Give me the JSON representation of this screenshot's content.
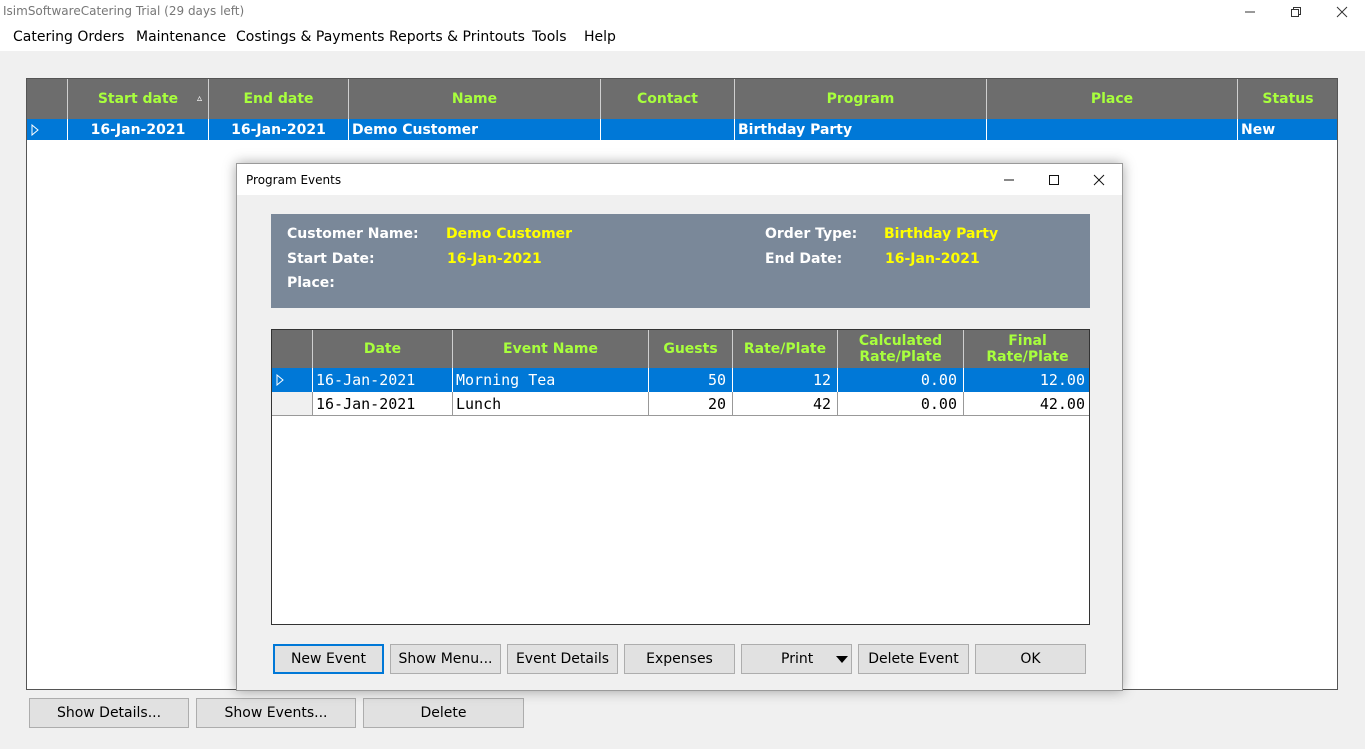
{
  "window": {
    "title": "IsimSoftwareCatering Trial (29 days left)",
    "controls": [
      "minimize-icon",
      "restore-icon",
      "close-icon"
    ]
  },
  "menu": {
    "items": [
      "Catering Orders",
      "Maintenance",
      "Costings & Payments",
      "Reports & Printouts",
      "Tools",
      "Help"
    ]
  },
  "orders_grid": {
    "columns": [
      "Start date",
      "End date",
      "Name",
      "Contact",
      "Program",
      "Place",
      "Status"
    ],
    "sort_indicator": "▵",
    "rows": [
      {
        "start_date": "16-Jan-2021",
        "end_date": "16-Jan-2021",
        "name": "Demo Customer",
        "contact": "",
        "program": "Birthday Party",
        "place": "",
        "status": "New",
        "selected": true
      }
    ]
  },
  "bottom_buttons": {
    "show_details": "Show Details...",
    "show_events": "Show Events...",
    "delete": "Delete"
  },
  "dialog": {
    "title": "Program Events",
    "info": {
      "customer_name_label": "Customer Name:",
      "customer_name": "Demo Customer",
      "start_date_label": "Start Date:",
      "start_date": "16-Jan-2021",
      "place_label": "Place:",
      "place": "",
      "order_type_label": "Order Type:",
      "order_type": "Birthday Party",
      "end_date_label": "End Date:",
      "end_date": "16-Jan-2021"
    },
    "events_grid": {
      "columns": [
        "Date",
        "Event Name",
        "Guests",
        "Rate/Plate",
        "Calculated Rate/Plate",
        "Final Rate/Plate"
      ],
      "rows": [
        {
          "date": "16-Jan-2021",
          "event_name": "Morning Tea",
          "guests": "50",
          "rate": "12",
          "calc_rate": "0.00",
          "final_rate": "12.00",
          "selected": true
        },
        {
          "date": "16-Jan-2021",
          "event_name": "Lunch",
          "guests": "20",
          "rate": "42",
          "calc_rate": "0.00",
          "final_rate": "42.00",
          "selected": false
        }
      ]
    },
    "buttons": {
      "new_event": "New Event",
      "show_menu": "Show Menu...",
      "event_details": "Event Details",
      "expenses": "Expenses",
      "print": "Print",
      "delete_event": "Delete Event",
      "ok": "OK"
    }
  },
  "colors": {
    "header_bg": "#6d6d6d",
    "header_text": "#a8ff3d",
    "selection": "#0078d7",
    "info_panel": "#7a8899",
    "info_value": "#ffff00"
  }
}
